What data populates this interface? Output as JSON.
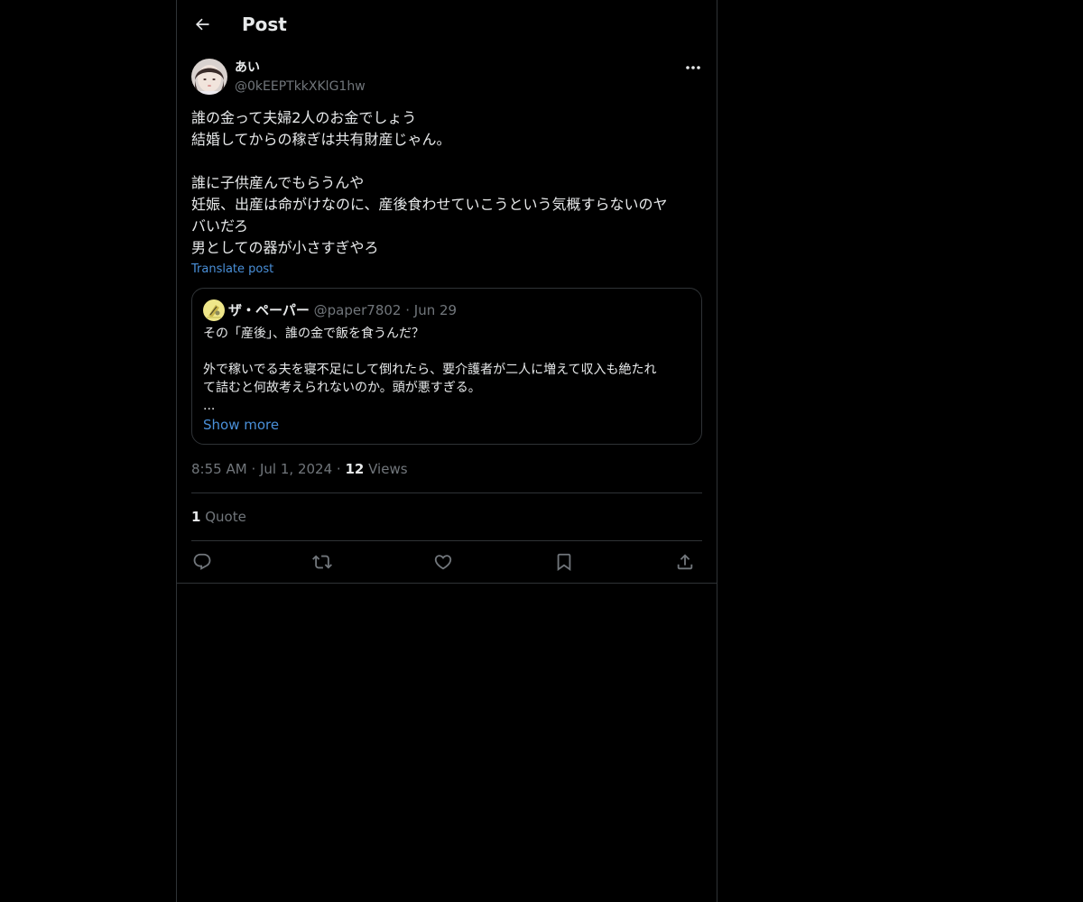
{
  "header": {
    "title": "Post",
    "back_icon": "arrow-left-icon"
  },
  "author": {
    "name": "あい",
    "handle": "@0kEEPTkkXKlG1hw"
  },
  "post": {
    "lines": [
      "誰の金って夫婦2人のお金でしょう",
      "結婚してからの稼ぎは共有財産じゃん。",
      "",
      "誰に子供産んでもらうんや",
      "妊娠、出産は命がけなのに、産後食わせていこうという気概すらないのヤ",
      "バいだろ",
      "男としての器が小さすぎやろ"
    ],
    "translate_label": "Translate post"
  },
  "quote": {
    "name": "ザ・ペーパー",
    "handle": "@paper7802",
    "separator": "·",
    "date": "Jun 29",
    "lines": [
      "その「産後」、誰の金で飯を食うんだ？",
      "",
      "外で稼いでる夫を寝不足にして倒れたら、要介護者が二人に増えて収入も絶たれ",
      "て詰むと何故考えられないのか。頭が悪すぎる。",
      "..."
    ],
    "show_more_label": "Show more"
  },
  "meta": {
    "time": "8:55 AM",
    "separator": "·",
    "date": "Jul 1, 2024",
    "views_count": "12",
    "views_label": "Views"
  },
  "stats": {
    "quote_count": "1",
    "quote_label": "Quote"
  },
  "actions": {
    "icons": [
      "reply-icon",
      "repost-icon",
      "like-icon",
      "bookmark-icon",
      "share-icon"
    ]
  },
  "colors": {
    "background": "#000000",
    "border": "#2f3336",
    "text_primary": "#e7e9ea",
    "text_secondary": "#71767b",
    "link": "#4a90d9"
  }
}
